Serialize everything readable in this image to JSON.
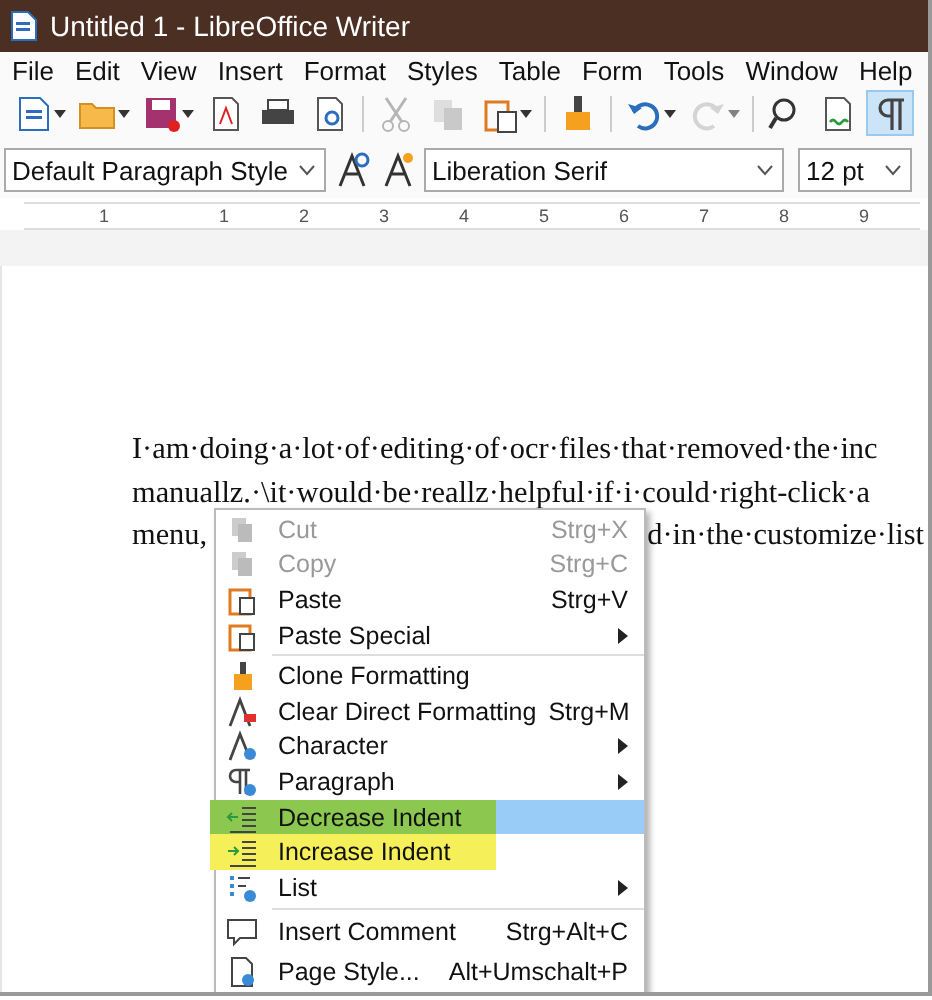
{
  "window": {
    "title": "Untitled 1 - LibreOffice Writer"
  },
  "menu_bar": [
    "File",
    "Edit",
    "View",
    "Insert",
    "Format",
    "Styles",
    "Table",
    "Form",
    "Tools",
    "Window",
    "Help"
  ],
  "toolbar": [
    {
      "disabled": false,
      "dropdown": true
    },
    {
      "disabled": false,
      "dropdown": true
    },
    {
      "disabled": false,
      "dropdown": true
    },
    {
      "disabled": false
    },
    {
      "disabled": false
    },
    {
      "disabled": false
    },
    {
      "disabled": true
    },
    {
      "disabled": true
    },
    {
      "disabled": false,
      "dropdown": true
    },
    {
      "disabled": false
    },
    {
      "disabled": false,
      "dropdown": true
    },
    {
      "disabled": true,
      "dropdown": true
    },
    {
      "disabled": false
    },
    {
      "disabled": false
    },
    {
      "disabled": false,
      "on": true
    }
  ],
  "formatting_bar": {
    "paragraph_style": "Default Paragraph Style",
    "font_name": "Liberation Serif",
    "font_size": "12 pt"
  },
  "ruler": {
    "labels": [
      "1",
      "1",
      "2",
      "3",
      "4",
      "5",
      "6",
      "7",
      "8",
      "9"
    ]
  },
  "document": {
    "lines": [
      {
        "left": "I·am·doing·a·lot·of·editing·of·ocr·files·that·removed·the·inc"
      },
      {
        "left": "manuallz.·\\it·would·be·reallz·helpful·if·i·could·right-click·a"
      },
      {
        "left": "menu,",
        "right": "d·in·the·customize·list"
      }
    ]
  },
  "context_menu": [
    {
      "kind": "item",
      "label": "Cut",
      "shortcut": "Strg+X",
      "disabled": true,
      "selected": false
    },
    {
      "kind": "item",
      "label": "Copy",
      "shortcut": "Strg+C",
      "disabled": true,
      "selected": false
    },
    {
      "kind": "item",
      "label": "Paste",
      "shortcut": "Strg+V",
      "disabled": false,
      "selected": false
    },
    {
      "kind": "item",
      "label": "Paste Special",
      "submenu": true,
      "disabled": false,
      "selected": false
    },
    {
      "kind": "separator"
    },
    {
      "kind": "item",
      "label": "Clone Formatting",
      "disabled": false,
      "selected": false
    },
    {
      "kind": "item",
      "label": "Clear Direct Formatting",
      "shortcut": "Strg+M",
      "disabled": false,
      "selected": false
    },
    {
      "kind": "item",
      "label": "Character",
      "submenu": true,
      "disabled": false,
      "selected": false
    },
    {
      "kind": "item",
      "label": "Paragraph",
      "submenu": true,
      "disabled": false,
      "selected": false
    },
    {
      "kind": "item",
      "label": "Decrease Indent",
      "disabled": false,
      "selected": true,
      "color": "#8cc850"
    },
    {
      "kind": "item",
      "label": "Increase Indent",
      "disabled": false,
      "selected": false,
      "color": "#f5f05a"
    },
    {
      "kind": "item",
      "label": "List",
      "submenu": true,
      "disabled": false,
      "selected": false
    },
    {
      "kind": "separator"
    },
    {
      "kind": "item",
      "label": "Insert Comment",
      "shortcut": "Strg+Alt+C",
      "disabled": false,
      "selected": false
    },
    {
      "kind": "item",
      "label": "Page Style...",
      "shortcut": "Alt+Umschalt+P",
      "disabled": false,
      "selected": false
    }
  ]
}
